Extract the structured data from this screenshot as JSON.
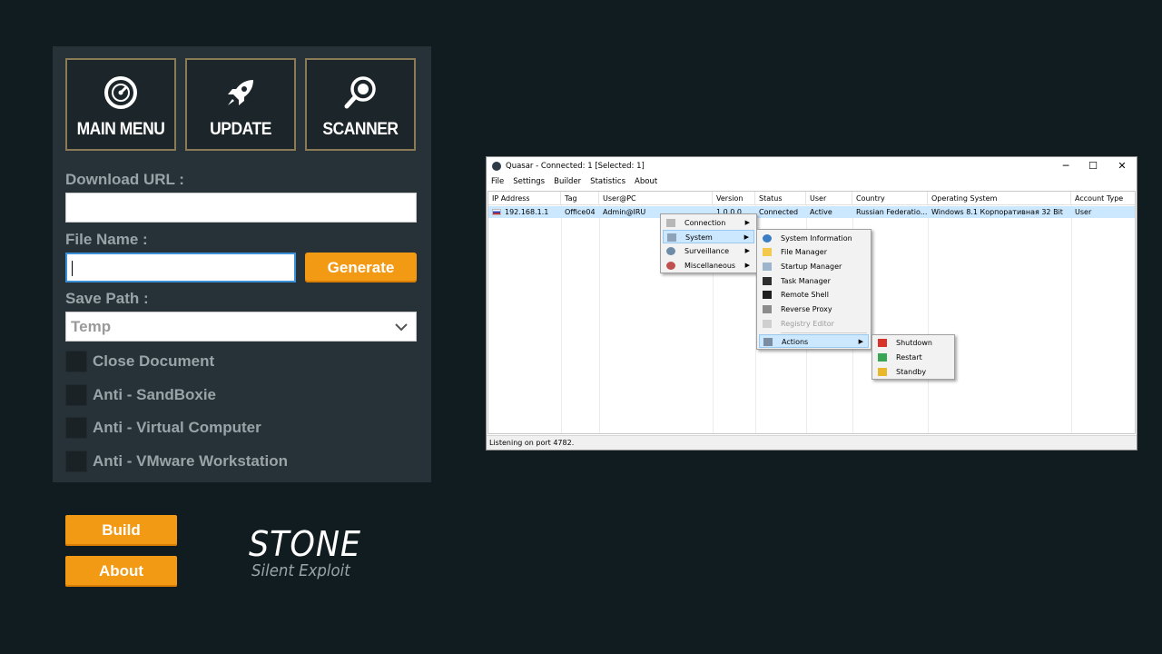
{
  "builder": {
    "nav": [
      {
        "label": "MAIN MENU",
        "icon": "dial-icon"
      },
      {
        "label": "UPDATE",
        "icon": "rocket-icon"
      },
      {
        "label": "SCANNER",
        "icon": "magnifier-icon"
      }
    ],
    "download_url_label": "Download URL :",
    "download_url_value": "",
    "file_name_label": "File Name :",
    "file_name_value": "",
    "generate_label": "Generate",
    "save_path_label": "Save Path :",
    "save_path_value": "Temp",
    "options": [
      {
        "label": "Close Document",
        "checked": false
      },
      {
        "label": "Anti - SandBoxie",
        "checked": false
      },
      {
        "label": "Anti - Virtual Computer",
        "checked": false
      },
      {
        "label": "Anti - VMware Workstation",
        "checked": false
      }
    ],
    "build_label": "Build",
    "about_label": "About",
    "accent_color": "#f39a14"
  },
  "logo": {
    "line1": "STONE",
    "line2": "Silent Exploit"
  },
  "quasar": {
    "title": "Quasar - Connected: 1 [Selected: 1]",
    "window_controls": {
      "minimize": "─",
      "maximize": "☐",
      "close": "✕"
    },
    "menu": [
      "File",
      "Settings",
      "Builder",
      "Statistics",
      "About"
    ],
    "columns": [
      "IP Address",
      "Tag",
      "User@PC",
      "Version",
      "Status",
      "User Status",
      "Country",
      "Operating System",
      "Account Type"
    ],
    "rows": [
      [
        "192.168.1.1",
        "Office04",
        "Admin@IRU",
        "1.0.0.0",
        "Connected",
        "Active",
        "Russian Federatio...",
        "Windows 8.1 Корпоративная 32 Bit",
        "User"
      ]
    ],
    "status": "Listening on port 4782.",
    "context_menu": [
      "Connection",
      "System",
      "Surveillance",
      "Miscellaneous"
    ],
    "system_menu": [
      "System Information",
      "File Manager",
      "Startup Manager",
      "Task Manager",
      "Remote Shell",
      "Reverse Proxy",
      "Registry Editor",
      "Actions"
    ],
    "actions_menu": [
      "Shutdown",
      "Restart",
      "Standby"
    ]
  }
}
